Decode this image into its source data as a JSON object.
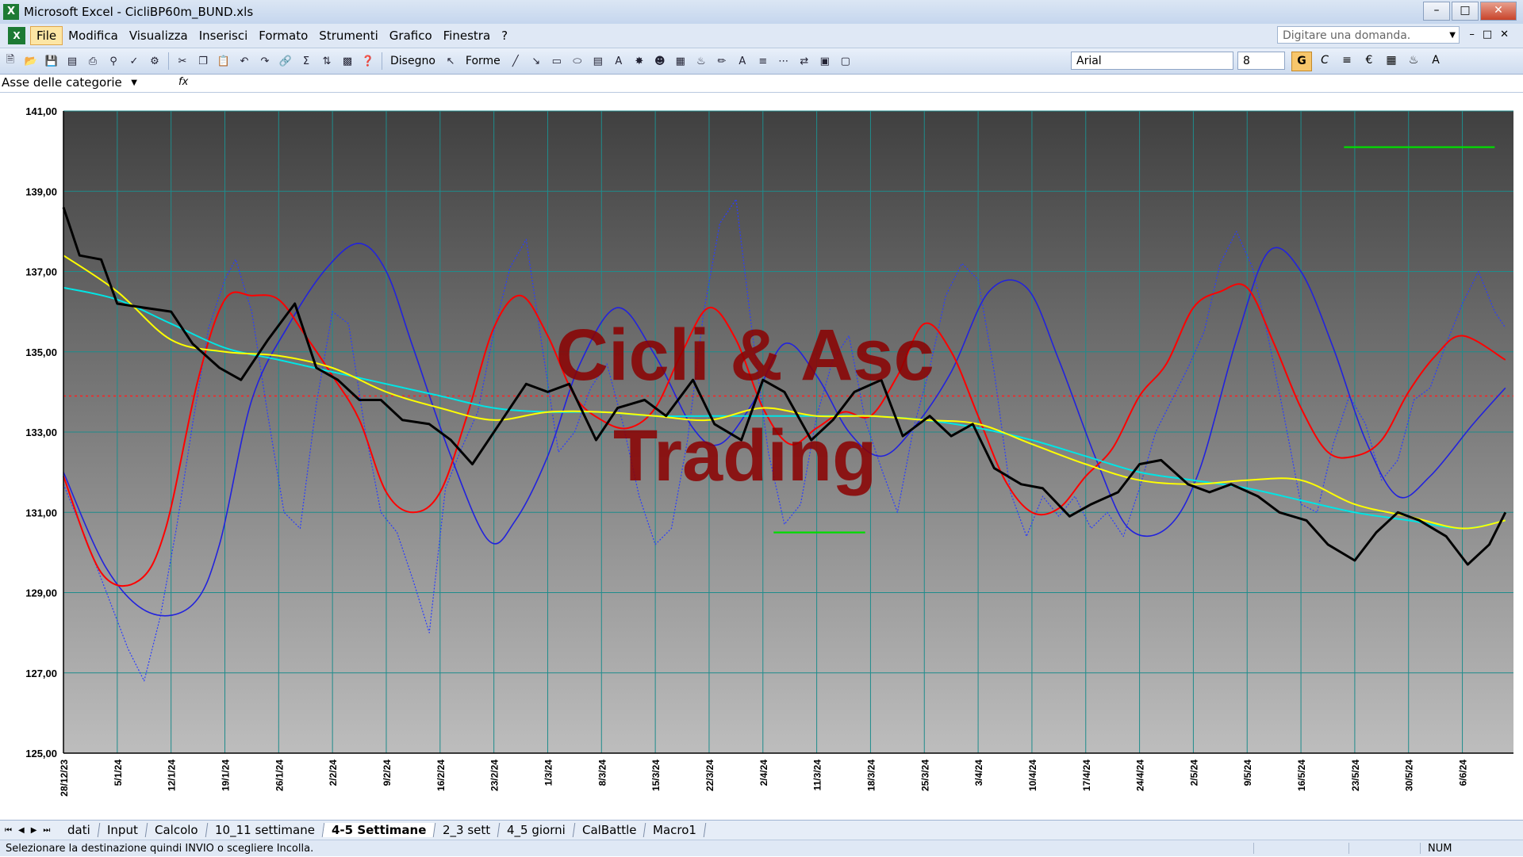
{
  "window": {
    "title": "Microsoft Excel - CicliBP60m_BUND.xls",
    "app_icon": "excel-icon"
  },
  "menu": {
    "items": [
      "File",
      "Modifica",
      "Visualizza",
      "Inserisci",
      "Formato",
      "Strumenti",
      "Grafico",
      "Finestra",
      "?"
    ],
    "help_placeholder": "Digitare una domanda."
  },
  "toolbar": {
    "disegno": "Disegno",
    "forme": "Forme",
    "font": "Arial",
    "size": "8",
    "bold": "G",
    "italic": "C"
  },
  "namebox": {
    "value": "Asse delle categorie",
    "fx": "fx"
  },
  "sheet_tabs": {
    "tabs": [
      "dati",
      "Input",
      "Calcolo",
      "10_11 settimane",
      "4-5 Settimane",
      "2_3 sett",
      "4_5 giorni",
      "CalBattle",
      "Macro1"
    ],
    "active": "4-5 Settimane"
  },
  "status": {
    "message": "Selezionare la destinazione quindi INVIO o scegliere Incolla.",
    "num": "NUM"
  },
  "colors": {
    "price": "#000000",
    "sma_fast": "#ffff00",
    "sma_slow": "#00e5e5",
    "cycle_red": "#ff0000",
    "cycle_blue": "#2222dd",
    "dotted": "#2a3cff",
    "midline": "#ff2020",
    "green": "#00dd00",
    "watermark": "#8b0000"
  },
  "chart_data": {
    "type": "line",
    "ylim": [
      125,
      141
    ],
    "yticks": [
      "141,00",
      "139,00",
      "137,00",
      "135,00",
      "133,00",
      "131,00",
      "129,00",
      "127,00",
      "125,00"
    ],
    "x_labels": [
      "28/12/23",
      "5/1/24",
      "12/1/24",
      "19/1/24",
      "26/1/24",
      "2/2/24",
      "9/2/24",
      "16/2/24",
      "23/2/24",
      "1/3/24",
      "8/3/24",
      "15/3/24",
      "22/3/24",
      "2/4/24",
      "11/3/24",
      "18/3/24",
      "25/3/24",
      "3/4/24",
      "10/4/24",
      "17/4/24",
      "24/4/24",
      "2/5/24",
      "9/5/24",
      "16/5/24",
      "23/5/24",
      "30/5/24",
      "6/6/24"
    ],
    "watermark": [
      "Cicli & Asc",
      "Trading"
    ],
    "hline": 133.9,
    "series": [
      {
        "key": "price",
        "x": [
          0,
          0.3,
          0.7,
          1,
          1.5,
          2,
          2.4,
          2.9,
          3.3,
          3.8,
          4.3,
          4.7,
          5.1,
          5.5,
          5.9,
          6.3,
          6.8,
          7.2,
          7.6,
          8.1,
          8.6,
          9,
          9.4,
          9.9,
          10.3,
          10.8,
          11.2,
          11.7,
          12.1,
          12.6,
          13,
          13.4,
          13.9,
          14.3,
          14.7,
          15.2,
          15.6,
          16.1,
          16.5,
          16.9,
          17.3,
          17.8,
          18.2,
          18.7,
          19.1,
          19.6,
          20,
          20.4,
          20.9,
          21.3,
          21.7,
          22.2,
          22.6,
          23.1,
          23.5,
          24,
          24.4,
          24.8,
          25.2,
          25.7,
          26.1,
          26.5,
          26.8
        ],
        "y": [
          138.6,
          137.4,
          137.3,
          136.2,
          136.1,
          136.0,
          135.2,
          134.6,
          134.3,
          135.3,
          136.2,
          134.6,
          134.3,
          133.8,
          133.8,
          133.3,
          133.2,
          132.8,
          132.2,
          133.2,
          134.2,
          134.0,
          134.2,
          132.8,
          133.6,
          133.8,
          133.4,
          134.3,
          133.2,
          132.8,
          134.3,
          134.0,
          132.8,
          133.3,
          134.0,
          134.3,
          132.9,
          133.4,
          132.9,
          133.2,
          132.1,
          131.7,
          131.6,
          130.9,
          131.2,
          131.5,
          132.2,
          132.3,
          131.7,
          131.5,
          131.7,
          131.4,
          131.0,
          130.8,
          130.2,
          129.8,
          130.5,
          131.0,
          130.8,
          130.4,
          129.7,
          130.2,
          131.0
        ]
      },
      {
        "key": "sma_fast",
        "x": [
          0,
          1,
          2,
          3,
          4,
          5,
          6,
          7,
          8,
          9,
          10,
          11,
          12,
          13,
          14,
          15,
          16,
          17,
          18,
          19,
          20,
          21,
          22,
          23,
          24,
          25,
          26,
          26.8
        ],
        "y": [
          137.4,
          136.5,
          135.3,
          135.0,
          134.9,
          134.6,
          134.0,
          133.6,
          133.3,
          133.5,
          133.5,
          133.4,
          133.3,
          133.6,
          133.4,
          133.4,
          133.3,
          133.2,
          132.7,
          132.2,
          131.8,
          131.7,
          131.8,
          131.8,
          131.2,
          130.9,
          130.6,
          130.8
        ]
      },
      {
        "key": "sma_slow",
        "x": [
          0,
          1,
          2,
          3,
          4,
          5,
          6,
          7,
          8,
          9,
          10,
          11,
          12,
          13,
          14,
          15,
          16,
          17,
          18,
          19,
          20,
          21,
          22,
          23,
          24,
          25,
          26,
          26.8
        ],
        "y": [
          136.6,
          136.3,
          135.7,
          135.1,
          134.8,
          134.5,
          134.2,
          133.9,
          133.6,
          133.5,
          133.5,
          133.4,
          133.4,
          133.4,
          133.4,
          133.4,
          133.3,
          133.1,
          132.8,
          132.4,
          132.0,
          131.8,
          131.6,
          131.3,
          131.0,
          130.8,
          130.6,
          130.8
        ]
      },
      {
        "key": "cycle_red",
        "x": [
          0,
          0.7,
          1.4,
          1.9,
          2.5,
          3,
          3.5,
          4,
          4.5,
          5,
          5.5,
          6,
          6.5,
          7,
          7.5,
          8,
          8.5,
          9,
          9.5,
          10,
          10.5,
          11,
          11.5,
          12,
          12.5,
          13,
          13.5,
          14,
          14.5,
          15,
          15.5,
          16,
          16.5,
          17,
          17.5,
          18,
          18.5,
          19,
          19.5,
          20,
          20.5,
          21,
          21.5,
          22,
          22.5,
          23,
          23.5,
          24,
          24.5,
          25,
          25.5,
          26,
          26.8
        ],
        "y": [
          131.9,
          129.5,
          129.3,
          130.6,
          134.3,
          136.3,
          136.4,
          136.3,
          135.4,
          134.4,
          133.3,
          131.5,
          131.0,
          131.5,
          133.4,
          135.6,
          136.4,
          135.4,
          133.9,
          133.3,
          133.1,
          133.6,
          135.0,
          136.1,
          135.3,
          133.6,
          132.7,
          133.1,
          133.5,
          133.4,
          134.4,
          135.7,
          135.0,
          133.4,
          131.8,
          131.0,
          131.1,
          131.9,
          132.6,
          133.9,
          134.7,
          136.1,
          136.5,
          136.6,
          135.2,
          133.6,
          132.5,
          132.4,
          132.8,
          134.0,
          134.9,
          135.4,
          134.8
        ]
      },
      {
        "key": "cycle_blue",
        "x": [
          0,
          0.8,
          1.6,
          2.4,
          2.9,
          3.5,
          4.2,
          4.9,
          5.5,
          6,
          6.5,
          7.2,
          7.9,
          8.4,
          9,
          9.6,
          10.3,
          11,
          11.7,
          12.2,
          12.8,
          13.4,
          14,
          14.6,
          15.2,
          15.8,
          16.5,
          17.2,
          17.9,
          18.5,
          19.2,
          19.8,
          20.5,
          21.1,
          21.8,
          22.4,
          23,
          23.6,
          24.2,
          24.8,
          25.4,
          26.2,
          26.8
        ],
        "y": [
          132.0,
          129.6,
          128.5,
          128.7,
          130.2,
          133.8,
          135.7,
          137.1,
          137.7,
          137.0,
          135.1,
          132.4,
          130.3,
          130.8,
          132.4,
          134.7,
          136.1,
          134.9,
          133.1,
          132.7,
          133.7,
          135.2,
          134.4,
          133.0,
          132.4,
          133.1,
          134.5,
          136.5,
          136.6,
          134.8,
          132.3,
          130.6,
          130.6,
          132.0,
          135.3,
          137.5,
          137.0,
          135.1,
          132.8,
          131.4,
          131.9,
          133.2,
          134.1
        ]
      },
      {
        "key": "dotted",
        "x": [
          0,
          0.4,
          0.8,
          1.2,
          1.5,
          1.8,
          2.1,
          2.4,
          2.7,
          3,
          3.2,
          3.5,
          3.8,
          4.1,
          4.4,
          4.7,
          5,
          5.3,
          5.6,
          5.9,
          6.2,
          6.5,
          6.8,
          7.1,
          7.4,
          7.7,
          8,
          8.3,
          8.6,
          8.9,
          9.2,
          9.5,
          9.8,
          10.1,
          10.4,
          10.7,
          11,
          11.3,
          11.6,
          11.9,
          12.2,
          12.5,
          12.8,
          13.1,
          13.4,
          13.7,
          14,
          14.3,
          14.6,
          14.9,
          15.2,
          15.5,
          15.8,
          16.1,
          16.4,
          16.7,
          17,
          17.3,
          17.6,
          17.9,
          18.2,
          18.5,
          18.8,
          19.1,
          19.4,
          19.7,
          20,
          20.3,
          20.6,
          20.9,
          21.2,
          21.5,
          21.8,
          22.1,
          22.4,
          22.7,
          23,
          23.3,
          23.6,
          23.9,
          24.2,
          24.5,
          24.8,
          25.1,
          25.4,
          25.7,
          26,
          26.3,
          26.6,
          26.8
        ],
        "y": [
          131.7,
          130.4,
          129.0,
          127.6,
          126.8,
          128.4,
          130.6,
          133.2,
          135.6,
          136.8,
          137.3,
          136.0,
          133.4,
          131.0,
          130.6,
          133.7,
          136.0,
          135.7,
          133.1,
          131.0,
          130.5,
          129.3,
          128.0,
          131.6,
          132.6,
          133.5,
          135.5,
          137.1,
          137.8,
          135.1,
          132.5,
          133.0,
          134.1,
          134.7,
          133.2,
          131.4,
          130.2,
          130.6,
          132.8,
          136.0,
          138.2,
          138.8,
          135.5,
          132.5,
          130.7,
          131.2,
          133.4,
          134.8,
          135.4,
          133.3,
          132.1,
          131.0,
          133.1,
          134.6,
          136.4,
          137.2,
          136.8,
          134.5,
          131.5,
          130.4,
          131.4,
          130.9,
          131.4,
          130.6,
          131.0,
          130.4,
          131.6,
          133.0,
          133.8,
          134.6,
          135.5,
          137.2,
          138.0,
          137.1,
          135.3,
          133.3,
          131.2,
          131.0,
          132.7,
          133.9,
          133.2,
          131.8,
          132.3,
          133.8,
          134.1,
          135.2,
          136.2,
          137.0,
          136.0,
          135.6
        ]
      },
      {
        "key": "green",
        "x": [
          23.8,
          26.6
        ],
        "y": [
          140.1,
          140.1
        ]
      },
      {
        "key": "green",
        "x": [
          13.2,
          14.9
        ],
        "y": [
          130.5,
          130.5
        ]
      }
    ]
  }
}
